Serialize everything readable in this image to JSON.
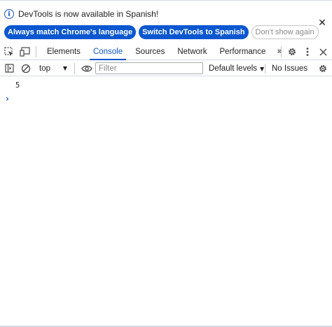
{
  "infobar": {
    "message": "DevTools is now available in Spanish!",
    "info_icon": "i",
    "close_icon": "✕",
    "buttons": {
      "match_language": "Always match Chrome's language",
      "switch_spanish": "Switch DevTools to Spanish",
      "dont_show": "Don't show again"
    }
  },
  "tabs": {
    "items": [
      {
        "label": "Elements",
        "active": false
      },
      {
        "label": "Console",
        "active": true
      },
      {
        "label": "Sources",
        "active": false
      },
      {
        "label": "Network",
        "active": false
      },
      {
        "label": "Performance",
        "active": false
      }
    ],
    "more_icon": "»"
  },
  "console_toolbar": {
    "context": "top",
    "filter_placeholder": "Filter",
    "levels": "Default levels",
    "issues": "No Issues"
  },
  "console": {
    "output": "5",
    "prompt": "›"
  },
  "colors": {
    "accent": "#0b57d0",
    "border": "#d6dbe6"
  }
}
